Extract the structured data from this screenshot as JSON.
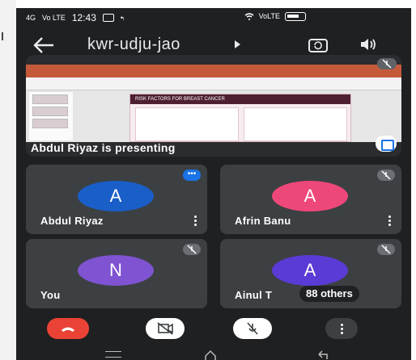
{
  "status_bar": {
    "signal": "4G",
    "signal_sub": "Vo LTE",
    "time": "12:43",
    "right_text": "VoLTE"
  },
  "header": {
    "meeting_code": "kwr-udju-jao"
  },
  "presentation": {
    "presenting_text": "Abdul Riyaz is presenting",
    "slide_title": "RISK FACTORS FOR BREAST CANCER"
  },
  "participants": [
    {
      "initial": "A",
      "name": "Abdul Riyaz",
      "color": "#1a5ec8"
    },
    {
      "initial": "A",
      "name": "Afrin Banu",
      "color": "#ee4779"
    },
    {
      "initial": "N",
      "name": "You",
      "color": "#7f53d1"
    },
    {
      "initial": "A",
      "name": "Ainul T",
      "color": "#5b3bd6"
    }
  ],
  "others_pill": "88 others",
  "colors": {
    "background": "#1f2022",
    "tile": "#3c4043",
    "end_call": "#ea4335",
    "accent_blue": "#1a73e8"
  }
}
